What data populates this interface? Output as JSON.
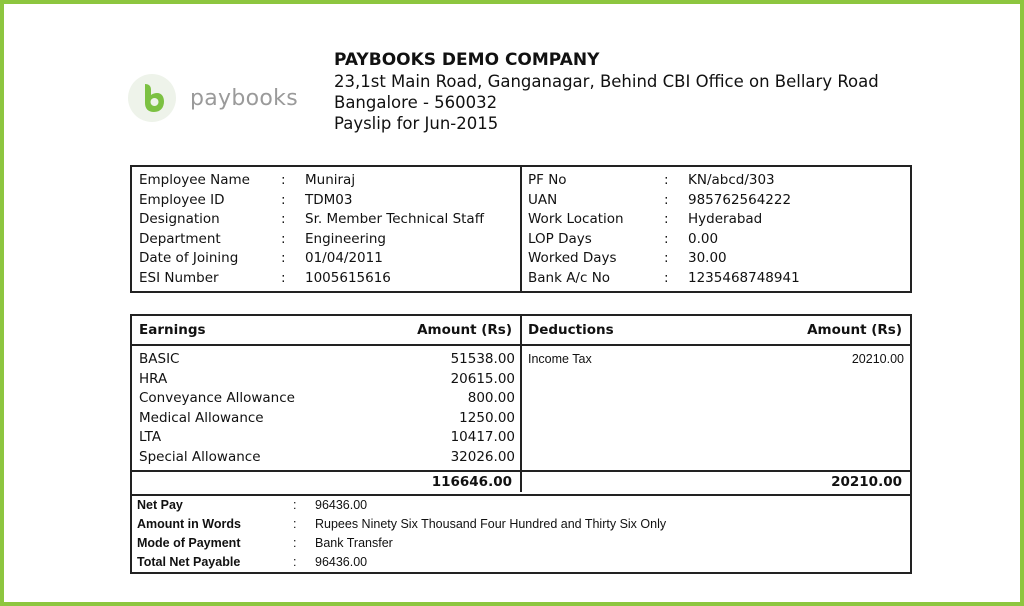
{
  "logo": {
    "text": "paybooks"
  },
  "header": {
    "company": "PAYBOOKS DEMO COMPANY",
    "address1": "23,1st Main Road, Ganganagar, Behind CBI Office on Bellary Road",
    "address2": "Bangalore - 560032",
    "payslip": "Payslip for Jun-2015"
  },
  "employee_left": [
    {
      "label": "Employee Name",
      "value": "Muniraj"
    },
    {
      "label": "Employee ID",
      "value": "TDM03"
    },
    {
      "label": "Designation",
      "value": "Sr. Member Technical Staff"
    },
    {
      "label": "Department",
      "value": "Engineering"
    },
    {
      "label": "Date of Joining",
      "value": "01/04/2011"
    },
    {
      "label": "ESI Number",
      "value": "1005615616"
    }
  ],
  "employee_right": [
    {
      "label": "PF No",
      "value": "KN/abcd/303"
    },
    {
      "label": "UAN",
      "value": "985762564222"
    },
    {
      "label": "Work Location",
      "value": "Hyderabad"
    },
    {
      "label": "LOP Days",
      "value": "0.00"
    },
    {
      "label": "Worked Days",
      "value": "30.00"
    },
    {
      "label": "Bank A/c No",
      "value": "1235468748941"
    }
  ],
  "separator": ":",
  "earnings": {
    "header": "Earnings",
    "amount_header": "Amount (Rs)",
    "items": [
      {
        "name": "BASIC",
        "amount": "51538.00"
      },
      {
        "name": "HRA",
        "amount": "20615.00"
      },
      {
        "name": "Conveyance Allowance",
        "amount": "800.00"
      },
      {
        "name": "Medical Allowance",
        "amount": "1250.00"
      },
      {
        "name": "LTA",
        "amount": "10417.00"
      },
      {
        "name": "Special Allowance",
        "amount": "32026.00"
      }
    ],
    "total": "116646.00"
  },
  "deductions": {
    "header": "Deductions",
    "amount_header": "Amount (Rs)",
    "items": [
      {
        "name": "Income Tax",
        "amount": "20210.00"
      }
    ],
    "total": "20210.00"
  },
  "summary": [
    {
      "label": "Net Pay",
      "value": "96436.00"
    },
    {
      "label": "Amount in Words",
      "value": "Rupees Ninety Six Thousand Four Hundred and Thirty Six Only"
    },
    {
      "label": "Mode of Payment",
      "value": "Bank Transfer"
    },
    {
      "label": "Total Net Payable",
      "value": "96436.00"
    }
  ],
  "colors": {
    "frame": "#8dc63f",
    "logo_green": "#7cc142",
    "logo_text": "#9a9a9a"
  }
}
